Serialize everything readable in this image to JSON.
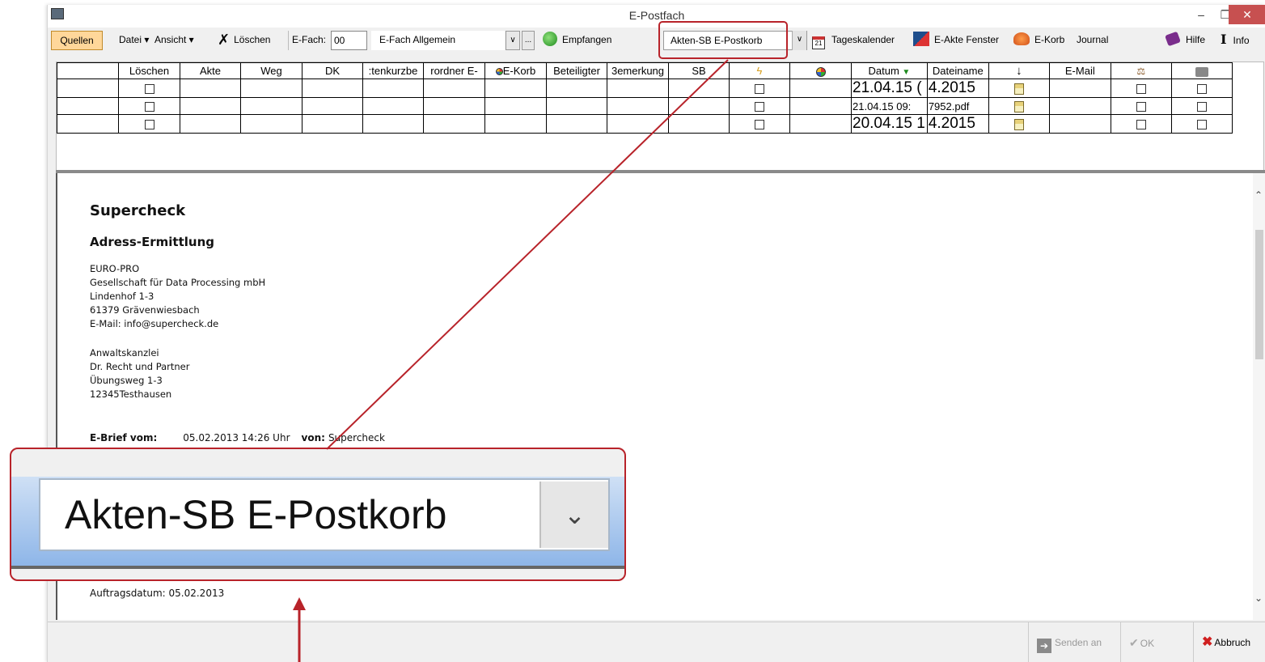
{
  "window": {
    "title": "E-Postfach",
    "min_glyph": "–",
    "max_glyph": "❐",
    "close_glyph": "✕"
  },
  "toolbar": {
    "quellen": "Quellen",
    "datei": "Datei ▾",
    "ansicht": "Ansicht ▾",
    "loeschen": "Löschen",
    "efach_label": "E-Fach:",
    "efach_value": "00",
    "efach_name": "E-Fach Allgemein",
    "dropdown_glyph": "∨",
    "dots_glyph": "...",
    "empfangen": "Empfangen",
    "postkorb": "Akten-SB E-Postkorb",
    "tageskalender": "Tageskalender",
    "calendar_number": "21",
    "eakte": "E-Akte Fenster",
    "ekorb": "E-Korb",
    "journal": "Journal",
    "hilfe": "Hilfe",
    "info": "Info"
  },
  "grid": {
    "headers": [
      "Löschen",
      "Akte",
      "Weg",
      "DK",
      ":tenkurzbe",
      "rordner E-",
      "E-Korb",
      "Beteiligter",
      "3emerkung",
      "SB",
      "",
      "",
      "Datum",
      "Dateiname",
      "",
      "E-Mail",
      "",
      ""
    ],
    "rows": [
      {
        "datum": "21.04.15 (",
        "dateiname": "4.2015",
        "size": "big"
      },
      {
        "datum": "21.04.15 09:",
        "dateiname": "7952.pdf",
        "size": "small"
      },
      {
        "datum": "20.04.15 1",
        "dateiname": "4.2015",
        "size": "big"
      }
    ]
  },
  "document": {
    "title": "Supercheck",
    "subtitle": "Adress-Ermittlung",
    "sender": [
      "EURO-PRO",
      "Gesellschaft für Data Processing mbH",
      "Lindenhof 1-3",
      "61379 Grävenwiesbach",
      "E-Mail: info@supercheck.de"
    ],
    "recipient": [
      "Anwaltskanzlei",
      "Dr. Recht und Partner",
      "Übungsweg 1-3",
      "12345Testhausen"
    ],
    "ebrief_label": "E-Brief vom:",
    "ebrief_date": "05.02.2013 14:26 Uhr",
    "von_label": "von:",
    "von_value": "Supercheck",
    "auftragsdatum": "Auftragsdatum: 05.02.2013"
  },
  "bottom": {
    "senden": "Senden an",
    "ok": "OK",
    "abbruch": "Abbruch"
  },
  "zoom": {
    "text": "Akten-SB E-Postkorb",
    "chevron": "⌄"
  },
  "colors": {
    "highlight": "#b8232a",
    "quellen_bg": "#ffd79a"
  }
}
